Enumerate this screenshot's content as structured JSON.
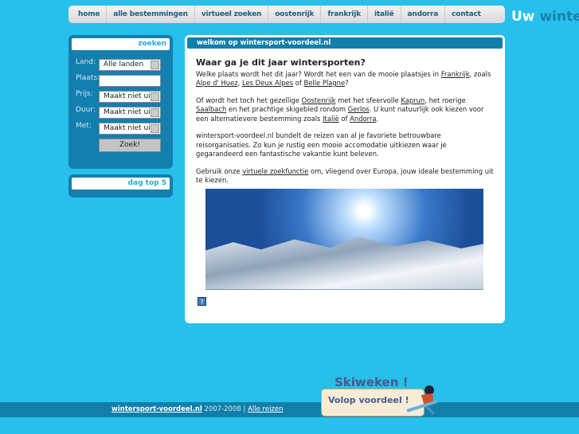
{
  "nav": {
    "items": [
      "home",
      "alle bestemmingen",
      "virtueel zoeken",
      "oostenrijk",
      "frankrijk",
      "italië",
      "andorra",
      "contact"
    ]
  },
  "logo": {
    "part1": "Uw",
    "part2": "winters"
  },
  "search": {
    "title": "zoeken",
    "land_label": "Land:",
    "land_value": "Alle landen",
    "plaats_label": "Plaats:",
    "plaats_value": "",
    "prijs_label": "Prijs:",
    "prijs_value": "Maakt niet uit",
    "duur_label": "Duur:",
    "duur_value": "Maakt niet uit",
    "met_label": "Met:",
    "met_value": "Maakt niet uit",
    "button": "Zoek!"
  },
  "top5": {
    "title": "dag top 5"
  },
  "main": {
    "header": "welkom op wintersport-voordeel.nl",
    "title": "Waar ga je dit jaar wintersporten?",
    "p1": {
      "a": "Welke plaats wordt het dit jaar? Wordt het een van de mooie plaatsjes in ",
      "l1": "Frankrijk",
      "b": ", zoals ",
      "l2": "Alpe d' Huez",
      "c": ", ",
      "l3": "Les Deux Alpes",
      "d": " of ",
      "l4": "Belle Plagne",
      "e": "?"
    },
    "p2": {
      "a": "Of wordt het toch het gezellige ",
      "l1": "Oostenrijk",
      "b": " met het sfeervolle ",
      "l2": "Kaprun",
      "c": ", het roerige ",
      "l3": "Saalbach",
      "d": " en het prachtige skigebied rondom ",
      "l4": "Gerlos",
      "e": ". U kunt natuurlijk ook kiezen voor een alternatievere bestemming zoals ",
      "l5": "Italië",
      "f": " of ",
      "l6": "Andorra",
      "g": "."
    },
    "p3": "wintersport-voordeel.nl bundelt de reizen van al je favoriete betrouwbare reisorganisaties. Zo kun je rustig een mooie accomodatie uitkiezen waar je gegarandeerd een fantastische vakantie kunt beleven.",
    "p4": {
      "a": "Gebruik onze ",
      "l1": "virtuele zoekfunctie",
      "b": " om, vliegend over Europa, jouw ideale bestemming uit te kiezen."
    },
    "help": "?"
  },
  "footer": {
    "link": "wintersport-voordeel.nl",
    "years": " 2007-2008 | ",
    "link2": "Alle reizen"
  },
  "ad": {
    "title": "Skiweken !",
    "text": "Volop voordeel !"
  }
}
